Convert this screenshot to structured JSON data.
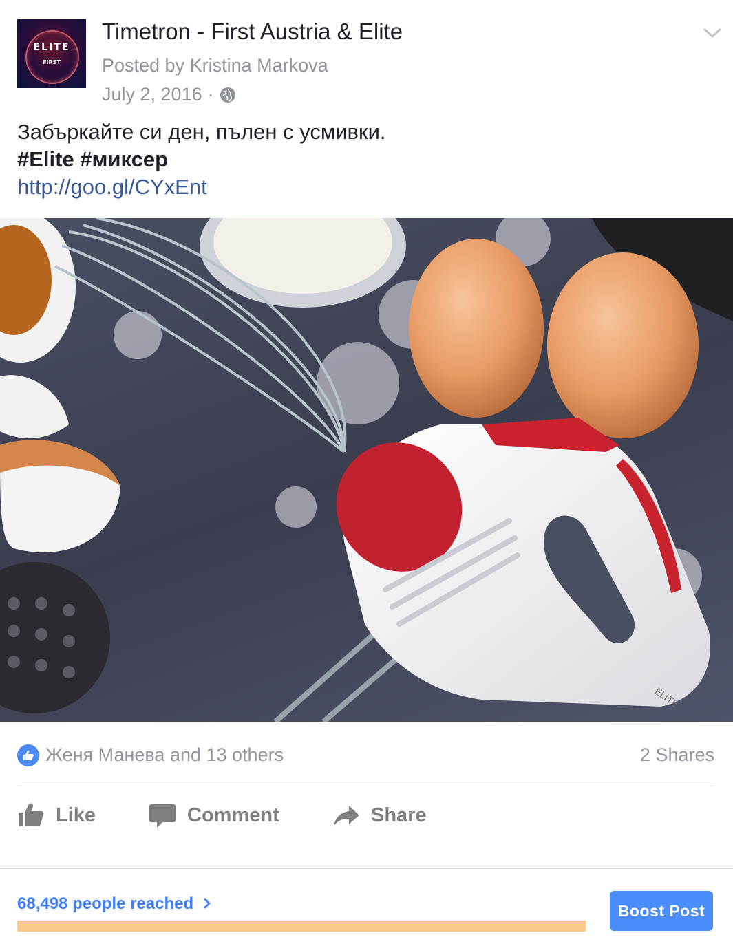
{
  "header": {
    "page_name": "Timetron - First Austria & Elite",
    "posted_by": "Posted by Kristina Markova",
    "date": "July 2, 2016",
    "separator": "·",
    "privacy_icon": "globe-icon",
    "menu_icon": "chevron-down-icon",
    "avatar": {
      "brand_text": "ELITE",
      "sub_text": "FIRST"
    }
  },
  "post": {
    "text": "Забъркайте си ден, пълен с усмивки.",
    "hashtags": "#Elite #миксер",
    "link": "http://goo.gl/CYxEnt"
  },
  "photo": {
    "product_brand": "ELITE"
  },
  "stats": {
    "reactions": "Женя Манева and 13 others",
    "shares": "2 Shares"
  },
  "actions": {
    "like": "Like",
    "comment": "Comment",
    "share": "Share"
  },
  "footer": {
    "reach": "68,498 people reached",
    "boost": "Boost Post"
  },
  "colors": {
    "link": "#365899",
    "reach": "#4080ff",
    "boost": "#4b8df8",
    "reach_bar": "#fbc98a",
    "like_badge": "#4c8bf5"
  }
}
